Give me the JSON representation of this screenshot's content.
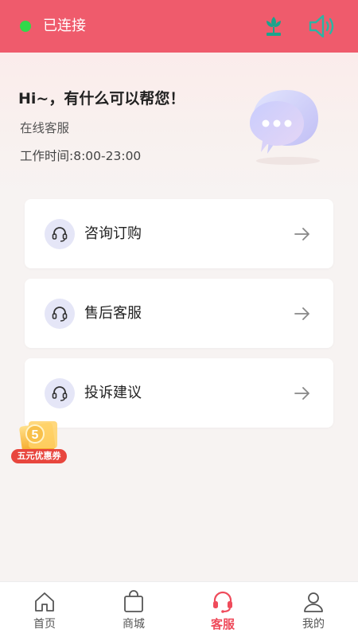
{
  "status": {
    "label": "已连接",
    "indicator_color": "#31d84a"
  },
  "topbar": {
    "bg_color": "#ef5b6c",
    "icons": [
      "flower-icon",
      "speaker-icon"
    ]
  },
  "hero": {
    "greeting": "Hi~，有什么可以帮您！",
    "subtitle": "在线客服",
    "hours": "工作时间:8:00-23:00",
    "illustration": "chat-bubble-icon"
  },
  "services": [
    {
      "label": "咨询订购",
      "icon": "headset-icon"
    },
    {
      "label": "售后客服",
      "icon": "headset-icon"
    },
    {
      "label": "投诉建议",
      "icon": "headset-icon"
    }
  ],
  "coupon": {
    "badge_number": "5",
    "label": "五元优惠券"
  },
  "bottom_nav": {
    "active_color": "#ef4b5b",
    "items": [
      {
        "label": "首页",
        "icon": "home-icon"
      },
      {
        "label": "商城",
        "icon": "shopping-bag-icon"
      },
      {
        "label": "客服",
        "icon": "headset-icon",
        "active": true
      },
      {
        "label": "我的",
        "icon": "user-icon"
      }
    ]
  }
}
